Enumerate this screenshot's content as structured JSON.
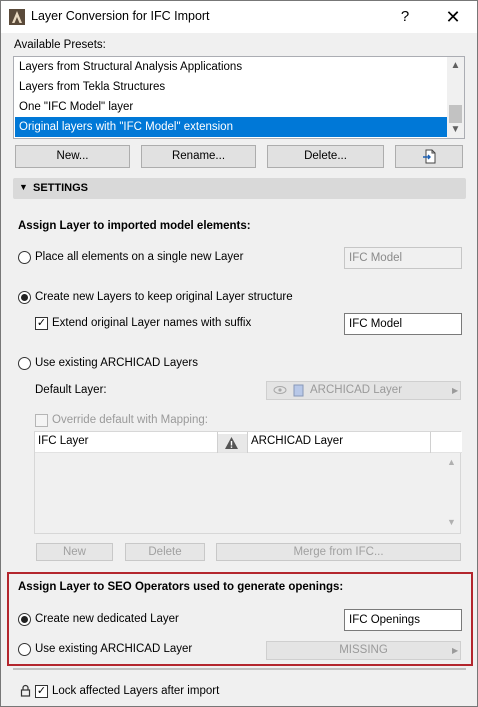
{
  "window": {
    "title": "Layer Conversion for IFC Import",
    "help_label": "?",
    "close_label": "✕"
  },
  "presets": {
    "label": "Available Presets:",
    "items": [
      {
        "label": "Layers from Structural Analysis Applications",
        "selected": false
      },
      {
        "label": "Layers from Tekla Structures",
        "selected": false
      },
      {
        "label": "One \"IFC Model\" layer",
        "selected": false
      },
      {
        "label": "Original layers with \"IFC Model\" extension",
        "selected": true
      }
    ],
    "buttons": {
      "new": "New...",
      "rename": "Rename...",
      "delete": "Delete..."
    }
  },
  "settings": {
    "header": "SETTINGS",
    "assign_heading": "Assign Layer to imported model elements:",
    "option_single": {
      "label": "Place all elements on a single new Layer",
      "value": "IFC Model",
      "selected": false
    },
    "option_create": {
      "label": "Create new Layers to keep original Layer structure",
      "selected": true,
      "suffix_label": "Extend original Layer names with suffix",
      "suffix_checked": true,
      "suffix_value": "IFC Model"
    },
    "option_existing": {
      "label": "Use existing ARCHICAD Layers",
      "selected": false,
      "default_layer_label": "Default Layer:",
      "default_layer_value": "ARCHICAD Layer",
      "override_label": "Override default with Mapping:",
      "override_checked": false
    },
    "mapping_table": {
      "headers": [
        "IFC Layer",
        "ARCHICAD Layer"
      ]
    },
    "mapping_buttons": {
      "new": "New",
      "delete": "Delete",
      "merge": "Merge from IFC..."
    }
  },
  "seo": {
    "heading": "Assign Layer to SEO Operators used to generate openings:",
    "option_create": {
      "label": "Create new dedicated Layer",
      "selected": true,
      "value": "IFC Openings"
    },
    "option_existing": {
      "label": "Use existing ARCHICAD Layer",
      "selected": false,
      "value": "MISSING"
    }
  },
  "footer": {
    "lock_label": "Lock affected Layers after import",
    "lock_checked": true
  },
  "colors": {
    "selection": "#0078d7",
    "highlight_border": "#b3262d"
  }
}
